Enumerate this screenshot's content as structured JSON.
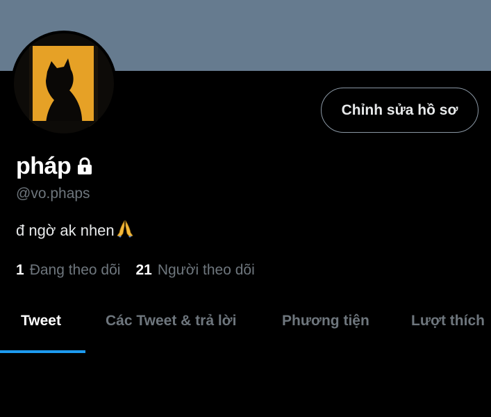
{
  "profile": {
    "name": "pháp",
    "handle": "@vo.phaps",
    "bio": "đ ngờ ak nhen",
    "edit_button_label": "Chỉnh sửa hồ sơ",
    "locked_icon": "lock-icon",
    "bio_emoji_icon": "folded-hands-icon"
  },
  "stats": {
    "following_count": "1",
    "following_label": "Đang theo dõi",
    "followers_count": "21",
    "followers_label": "Người theo dõi"
  },
  "tabs": [
    {
      "label": "Tweet",
      "active": true
    },
    {
      "label": "Các Tweet & trả lời",
      "active": false
    },
    {
      "label": "Phương tiện",
      "active": false
    },
    {
      "label": "Lượt thích",
      "active": false
    }
  ],
  "colors": {
    "banner": "#667b8f",
    "background": "#000000",
    "accent": "#1d9bf0",
    "secondary_text": "#6e767d"
  }
}
